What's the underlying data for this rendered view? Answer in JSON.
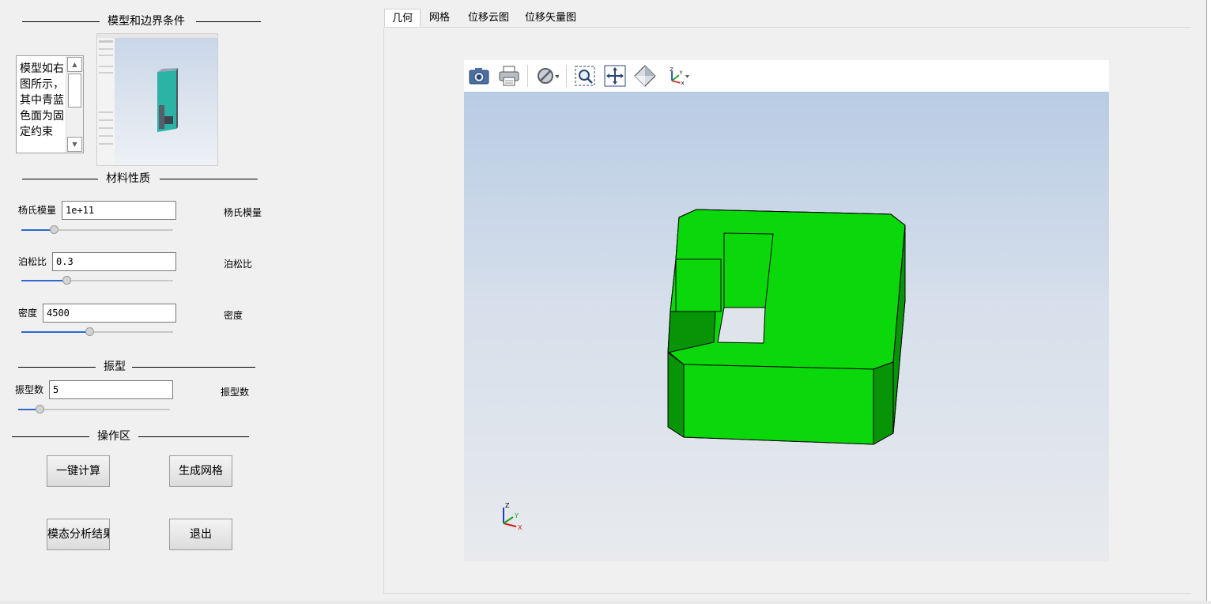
{
  "left_panel": {
    "model_group_title": "模型和边界条件",
    "model_description": "模型如右图所示，其中青蓝色面为固定约束",
    "material_group_title": "材料性质",
    "youngs": {
      "label": "杨氏模量",
      "value": "1e+11",
      "side_label": "杨氏模量",
      "slider_fraction": 0.2
    },
    "poisson": {
      "label": "泊松比",
      "value": "0.3",
      "side_label": "泊松比",
      "slider_fraction": 0.29
    },
    "density": {
      "label": "密度",
      "value": "4500",
      "side_label": "密度",
      "slider_fraction": 0.45
    },
    "mode_group_title": "振型",
    "mode_count": {
      "label": "振型数",
      "value": "5",
      "side_label": "振型数",
      "slider_fraction": 0.12
    },
    "ops_group_title": "操作区",
    "buttons": {
      "compute": "一键计算",
      "mesh": "生成网格",
      "modal": "模态分析结果",
      "exit": "退出"
    }
  },
  "tabs": [
    "几何",
    "网格",
    "位移云图",
    "位移矢量图"
  ],
  "active_tab": 0,
  "viewer": {
    "toolbar_icons": [
      "camera-icon",
      "print-icon",
      "display-mode-icon",
      "zoom-window-icon",
      "fit-all-icon",
      "view-cube-icon",
      "axes-orientation-icon"
    ],
    "model_color": "#0ad80a",
    "model_dark_color": "#079407",
    "background_top": "#b9cce4",
    "background_bottom": "#e8eaed",
    "triad_labels": {
      "x": "X",
      "y": "Y",
      "z": "Z"
    }
  }
}
